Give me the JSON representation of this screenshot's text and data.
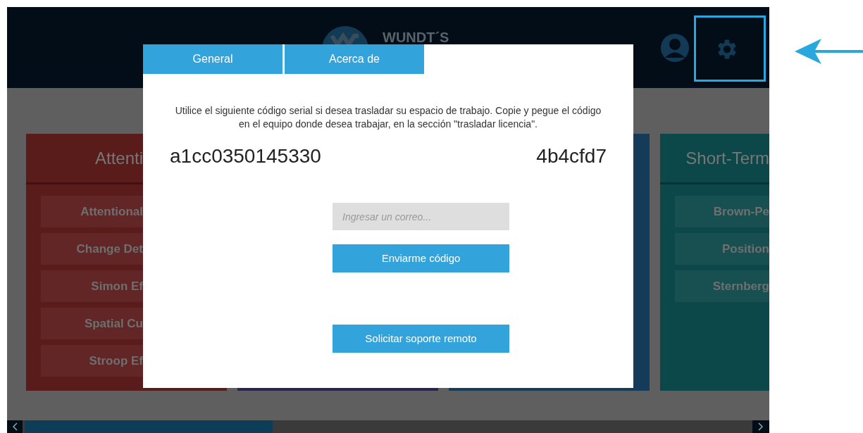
{
  "header": {
    "logo_text": "WUNDT´S"
  },
  "categories": [
    {
      "title": "Attenti",
      "color": "#5a1b1b",
      "items": [
        "Attentional",
        "Change Det",
        "Simon Ef",
        "Spatial Cu",
        "Stroop Ef"
      ]
    },
    {
      "color": "#2a2550"
    },
    {
      "color": "#143b5a"
    },
    {
      "title": "Short-Term",
      "color": "#0c4749",
      "items": [
        "Brown-Pe",
        "Position",
        "Sternberg"
      ]
    }
  ],
  "dialog": {
    "tabs": [
      {
        "label": "General"
      },
      {
        "label": "Acerca de"
      }
    ],
    "message": "Utilice el siguiente código serial si desea trasladar su espacio de trabajo. Copie y pegue el código en el equipo donde desea trabajar, en la sección \"trasladar licencia\".",
    "serial": {
      "part_1": "a1cc0350145330",
      "part_2": "4b4cfd7"
    },
    "email_field": {
      "placeholder": "Ingresar un correo..."
    },
    "send_button": "Enviarme código",
    "support_button": "Solicitar soporte remoto"
  }
}
